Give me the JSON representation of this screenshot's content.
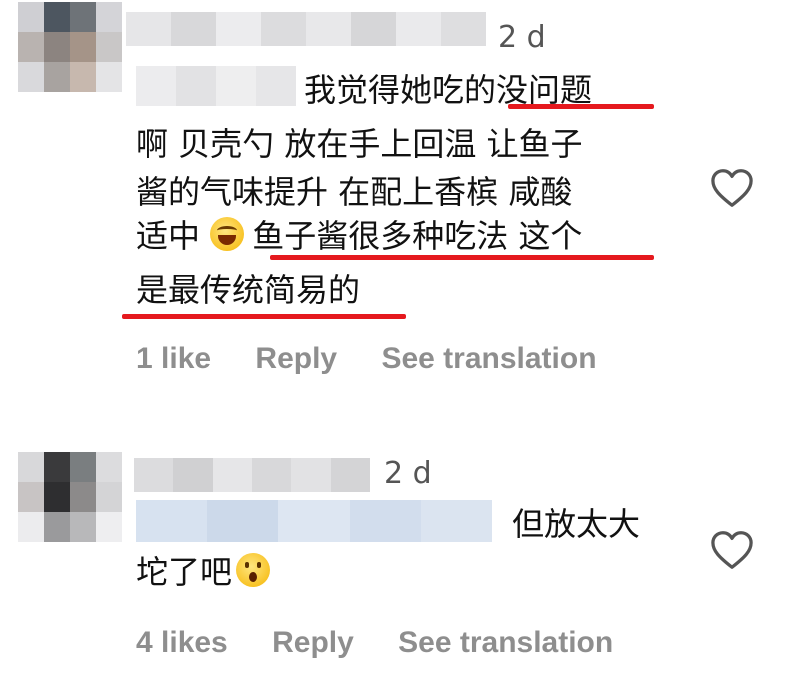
{
  "comments": [
    {
      "time": "2 d",
      "lines": [
        "我觉得她吃的没问题",
        "啊 贝壳勺 放在手上回温 让鱼子",
        "酱的气味提升 在配上香槟 咸酸",
        "适中",
        "鱼子酱很多种吃法 这个",
        "是最传统简易的"
      ],
      "likes_label": "1 like",
      "reply_label": "Reply",
      "translate_label": "See translation"
    },
    {
      "time": "2 d",
      "lines": [
        "但放太大",
        "坨了吧"
      ],
      "likes_label": "4 likes",
      "reply_label": "Reply",
      "translate_label": "See translation"
    }
  ],
  "icons": {
    "like": "heart-outline-icon",
    "emoji1": "face-with-tears-of-joy",
    "emoji2": "astonished-face"
  },
  "colors": {
    "underline": "#e5191e",
    "meta": "#8e8e8e"
  }
}
